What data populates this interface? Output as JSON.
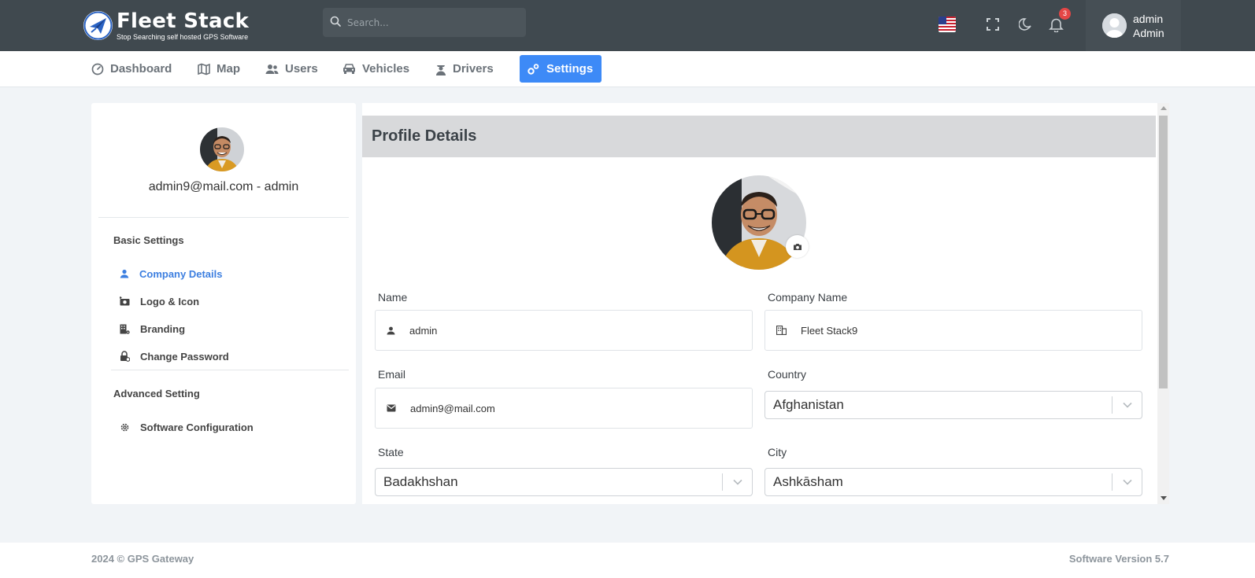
{
  "brand": {
    "title": "Fleet Stack",
    "tagline": "Stop Searching self hosted GPS Software"
  },
  "search": {
    "placeholder": "Search..."
  },
  "header": {
    "notification_count": "3",
    "user_name": "admin",
    "user_role": "Admin",
    "icons": [
      "us-flag-icon",
      "fullscreen-icon",
      "moon-icon",
      "bell-icon"
    ]
  },
  "nav": {
    "items": [
      {
        "label": "Dashboard",
        "icon": "dashboard-icon"
      },
      {
        "label": "Map",
        "icon": "map-icon"
      },
      {
        "label": "Users",
        "icon": "users-icon"
      },
      {
        "label": "Vehicles",
        "icon": "car-icon"
      },
      {
        "label": "Drivers",
        "icon": "driver-icon"
      },
      {
        "label": "Settings",
        "icon": "gear-icon",
        "active": true
      }
    ]
  },
  "sidebar": {
    "email_line": "admin9@mail.com - admin",
    "basic_heading": "Basic Settings",
    "basic_items": [
      {
        "label": "Company Details",
        "icon": "user-icon",
        "active": true
      },
      {
        "label": "Logo & Icon",
        "icon": "camera-plus-icon"
      },
      {
        "label": "Branding",
        "icon": "building-gear-icon"
      },
      {
        "label": "Change Password",
        "icon": "lock-reset-icon"
      }
    ],
    "advanced_heading": "Advanced Setting",
    "advanced_items": [
      {
        "label": "Software Configuration",
        "icon": "gear-icon"
      }
    ]
  },
  "profile": {
    "title": "Profile Details",
    "name_label": "Name",
    "name_value": "admin",
    "company_label": "Company Name",
    "company_value": "Fleet Stack9",
    "email_label": "Email",
    "email_value": "admin9@mail.com",
    "country_label": "Country",
    "country_value": "Afghanistan",
    "state_label": "State",
    "state_value": "Badakhshan",
    "city_label": "City",
    "city_value": "Ashkāsham"
  },
  "footer": {
    "copyright": "2024 © GPS Gateway",
    "version": "Software Version 5.7"
  },
  "colors": {
    "topbar": "#40494f",
    "accent": "#3d8af7",
    "active_link": "#3d7fe0",
    "badge": "#e54646"
  }
}
